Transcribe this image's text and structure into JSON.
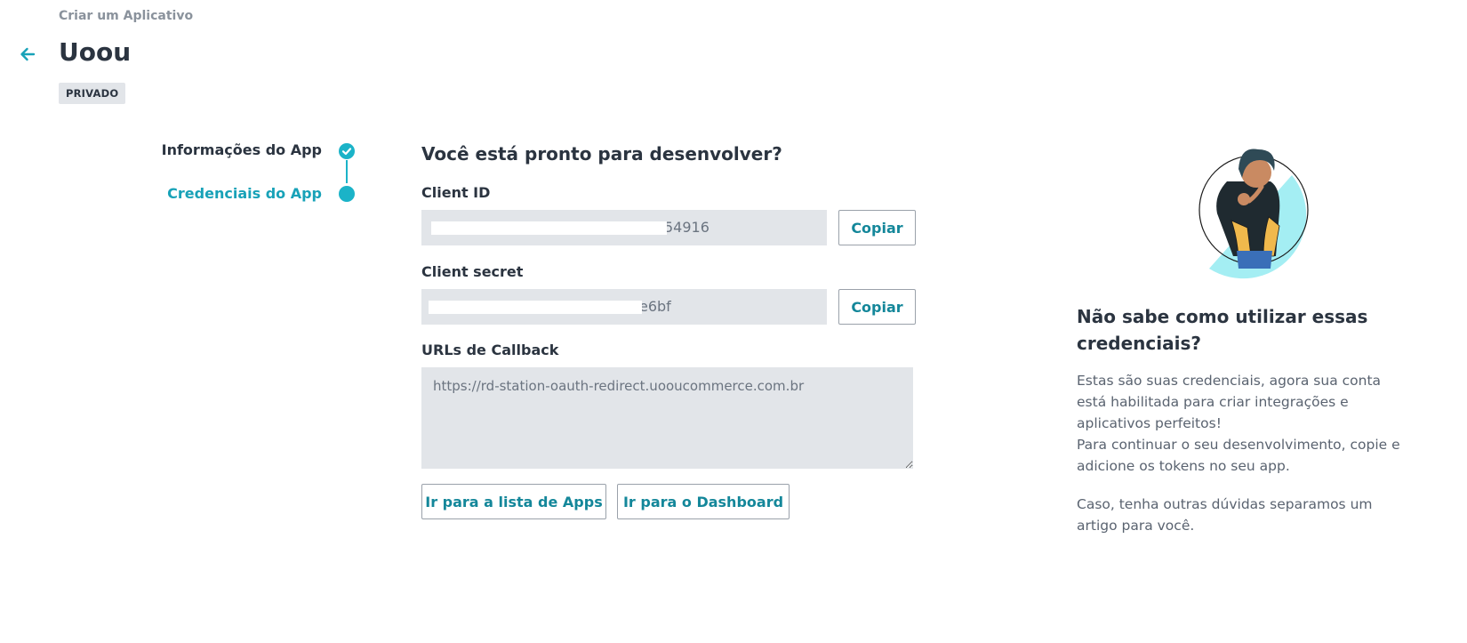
{
  "header": {
    "breadcrumb": "Criar um Aplicativo",
    "title": "Uoou",
    "badge": "PRIVADO"
  },
  "stepper": {
    "steps": [
      {
        "label": "Informações do App",
        "status": "completed"
      },
      {
        "label": "Credenciais do App",
        "status": "active"
      }
    ]
  },
  "main": {
    "heading": "Você está pronto para desenvolver?",
    "client_id": {
      "label": "Client ID",
      "visible_value": "54916",
      "copy_label": "Copiar"
    },
    "client_secret": {
      "label": "Client secret",
      "visible_value": "e6bf",
      "copy_label": "Copiar"
    },
    "callback": {
      "label": "URLs de Callback",
      "value": "https://rd-station-oauth-redirect.uooucommerce.com.br"
    },
    "buttons": {
      "apps": "Ir para a lista de Apps",
      "dashboard": "Ir para o Dashboard"
    }
  },
  "help": {
    "title": "Não sabe como utilizar essas credenciais?",
    "paragraph_1a": "Estas são suas credenciais, agora sua conta está habilitada para criar integrações e aplicativos perfeitos!",
    "paragraph_1b": "Para continuar o seu desenvolvimento, copie e adicione os tokens no seu app.",
    "paragraph_2": "Caso, tenha outras dúvidas separamos um artigo para você."
  },
  "colors": {
    "accent": "#1bb3c8",
    "accent_text": "#14879a",
    "field_bg": "#e2e5e9",
    "heading": "#2b3440"
  },
  "icons": {
    "back": "arrow-left-icon",
    "step_done": "check-circle-icon",
    "step_active": "dot-icon"
  }
}
